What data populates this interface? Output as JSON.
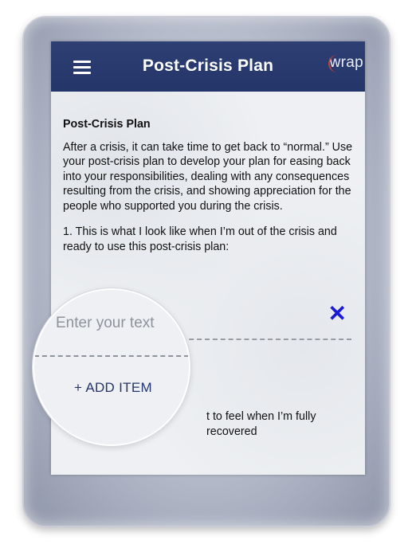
{
  "header": {
    "title": "Post-Crisis Plan",
    "logo_text": "wrap"
  },
  "content": {
    "section_title": "Post-Crisis Plan",
    "intro": "After a crisis, it can take time to get back to “normal.” Use your post-crisis plan to develop your plan for easing back into your responsibilities, dealing with any consequences resulting from the crisis, and showing appreciation for the people who supported you during the crisis.",
    "question_1": "1. This is what I look like when I’m out of the crisis and ready to use this post-crisis plan:",
    "question_2_visible": "t to feel when I’m fully recovered"
  },
  "entry": {
    "placeholder": "Enter your text",
    "clear_icon": "close-icon"
  },
  "magnifier": {
    "placeholder": "Enter your text",
    "add_item_label": "+ ADD ITEM"
  },
  "colors": {
    "header_bg": "#2a3a6e",
    "accent_x": "#1a1ad6",
    "add_item": "#26356a"
  }
}
